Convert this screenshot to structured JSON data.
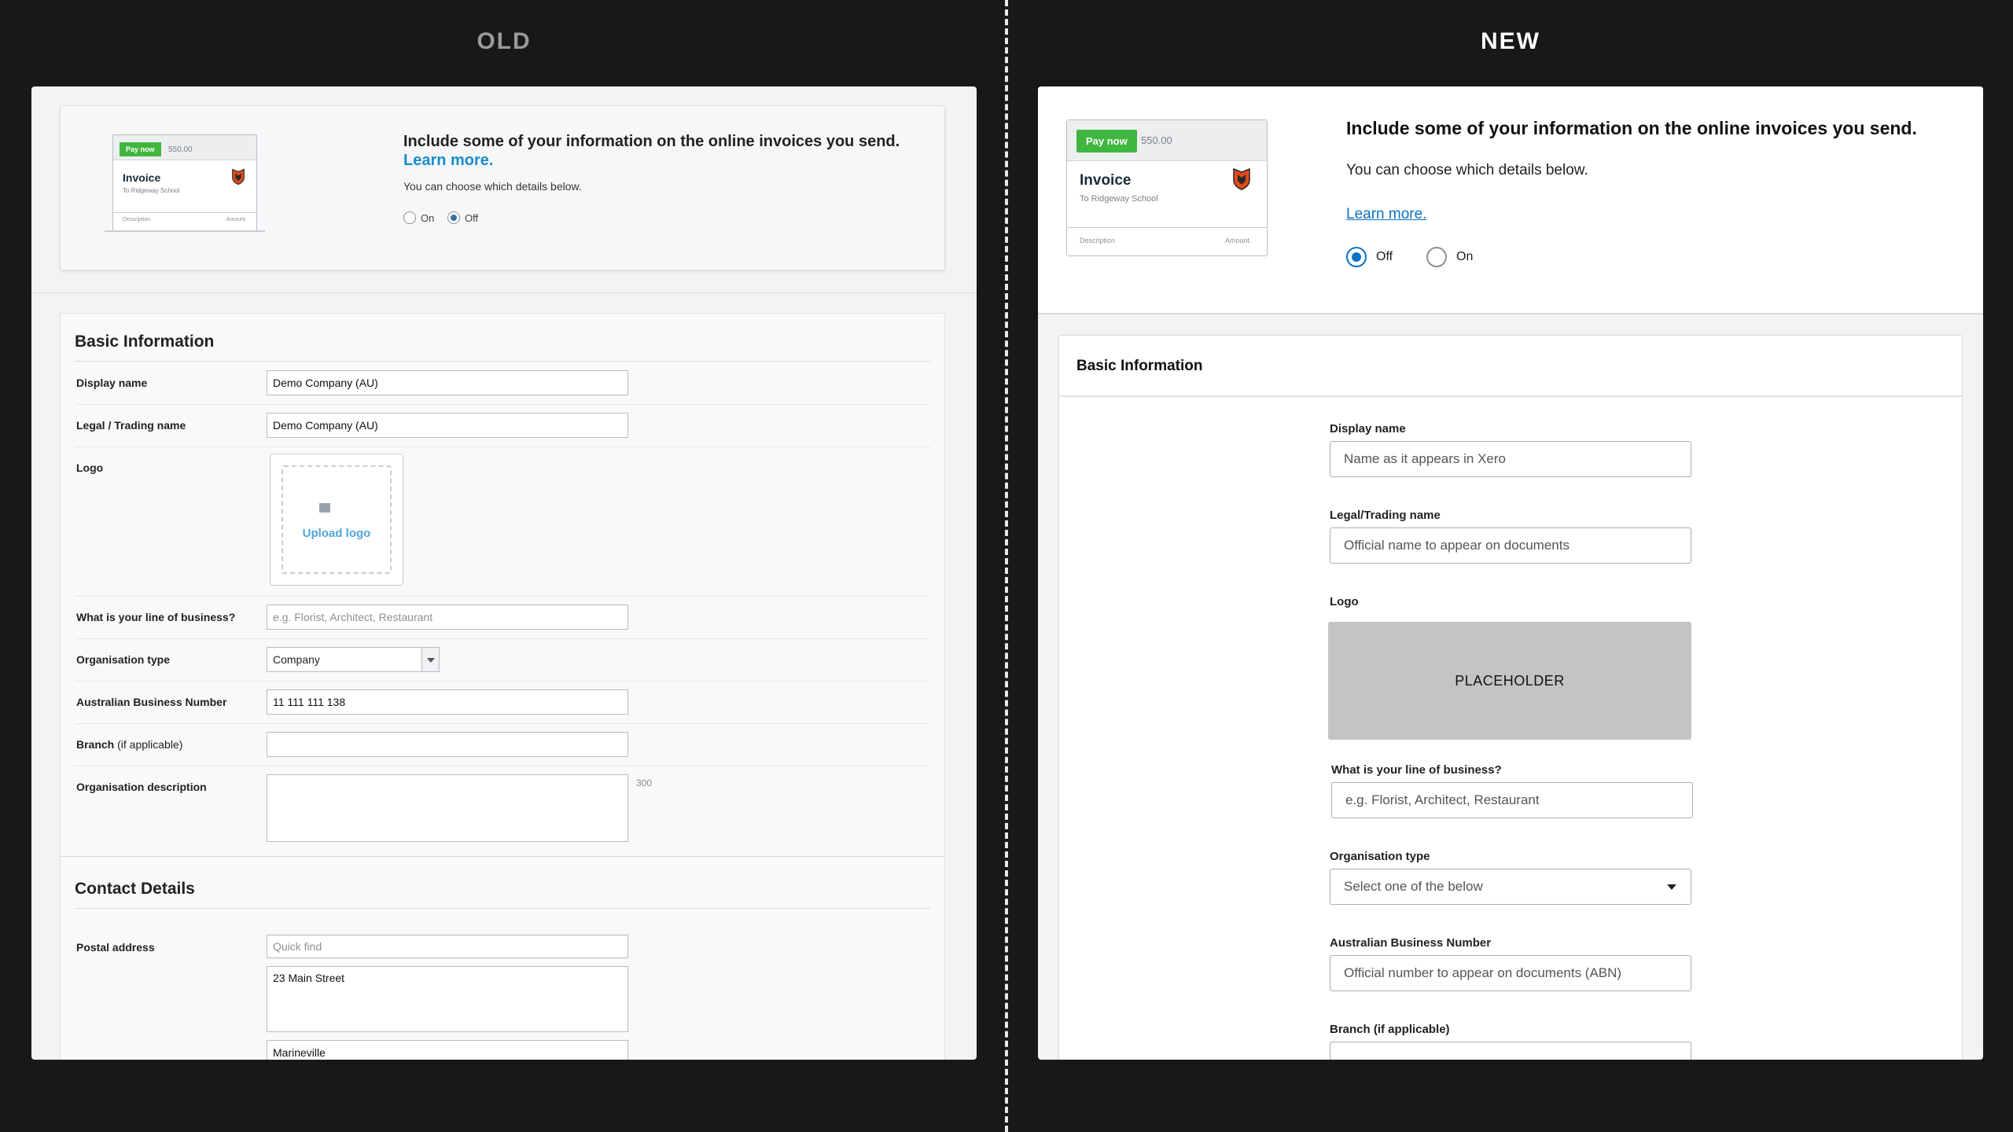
{
  "columns": {
    "old_title": "OLD",
    "new_title": "NEW"
  },
  "invoice_preview": {
    "pay_now": "Pay now",
    "amount": "550.00",
    "title": "Invoice",
    "to": "To Ridgeway School",
    "description_col": "Description",
    "amount_col": "Amount"
  },
  "old": {
    "banner": {
      "headline": "Include some of your information on the online invoices you send.",
      "learn_more": "Learn more.",
      "choose": "You can choose which details below.",
      "radio_on": "On",
      "radio_off": "Off",
      "selected": "Off"
    },
    "basic_info": {
      "heading": "Basic Information",
      "display_name_label": "Display name",
      "display_name_value": "Demo Company (AU)",
      "legal_name_label": "Legal / Trading name",
      "legal_name_value": "Demo Company (AU)",
      "logo_label": "Logo",
      "upload_logo": "Upload logo",
      "business_line_label": "What is your line of business?",
      "business_line_placeholder": "e.g. Florist, Architect, Restaurant",
      "org_type_label": "Organisation type",
      "org_type_value": "Company",
      "abn_label": "Australian Business Number",
      "abn_value": "11 111 111 138",
      "branch_label": "Branch",
      "branch_label_suffix": "(if applicable)",
      "branch_value": "",
      "org_desc_label": "Organisation description",
      "org_desc_count": "300"
    },
    "contact": {
      "heading": "Contact Details",
      "postal_label": "Postal address",
      "quick_find_placeholder": "Quick find",
      "street_value": "23 Main Street",
      "city_value": "Marineville"
    }
  },
  "new": {
    "banner": {
      "headline": "Include some of your information on the online invoices you send.",
      "choose": "You can choose which details below.",
      "learn_more": "Learn more.",
      "radio_off": "Off",
      "radio_on": "On",
      "selected": "Off"
    },
    "basic_info": {
      "heading": "Basic Information",
      "display_name_label": "Display name",
      "display_name_placeholder": "Name as it appears in Xero",
      "legal_name_label": "Legal/Trading name",
      "legal_name_placeholder": "Official name to appear on documents",
      "logo_label": "Logo",
      "logo_placeholder": "PLACEHOLDER",
      "business_line_label": "What is your line of business?",
      "business_line_placeholder": "e.g. Florist, Architect, Restaurant",
      "org_type_label": "Organisation type",
      "org_type_placeholder": "Select one of the below",
      "abn_label": "Australian Business Number",
      "abn_placeholder": "Official number to appear on documents (ABN)",
      "branch_label": "Branch (if applicable)"
    }
  },
  "colors": {
    "page_bg": "#181818",
    "pay_green": "#3fb73f",
    "old_link": "#1a8bcc",
    "new_link": "#0a72c7",
    "shield": "#e24a1a",
    "placeholder_bg": "#c4c4c4"
  },
  "icons": [
    "shield-logo-icon",
    "image-icon",
    "chevron-down-icon"
  ]
}
